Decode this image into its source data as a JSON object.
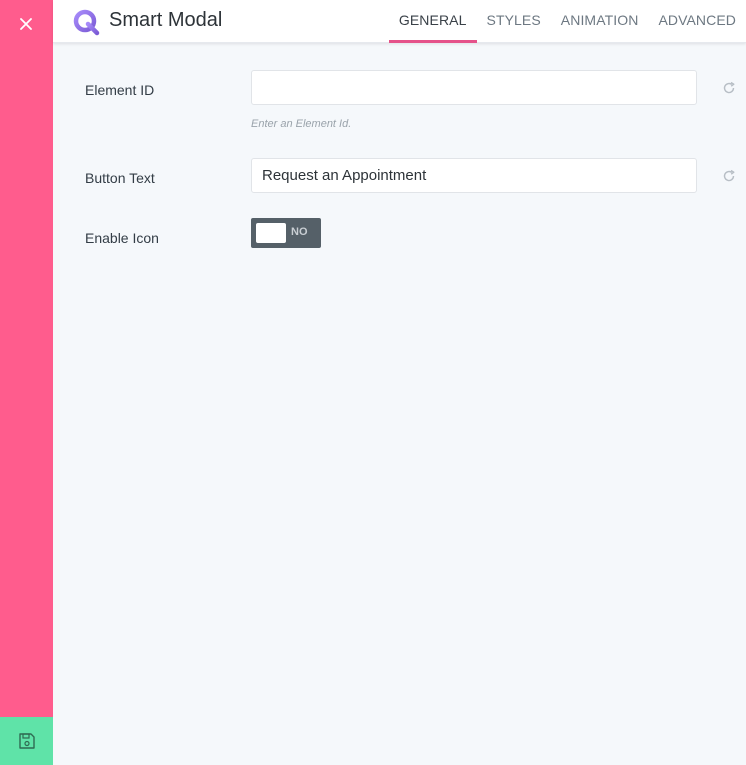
{
  "app": {
    "title": "Smart Modal",
    "colors": {
      "sidebar": "#ff5c8d",
      "save": "#5fe3a8",
      "accent": "#e5528a"
    }
  },
  "sidebar": {
    "close_icon": "close-icon",
    "save_icon": "save-icon"
  },
  "tabs": [
    {
      "label": "GENERAL",
      "active": true
    },
    {
      "label": "STYLES",
      "active": false
    },
    {
      "label": "ANIMATION",
      "active": false
    },
    {
      "label": "ADVANCED",
      "active": false
    }
  ],
  "form": {
    "element_id": {
      "label": "Element ID",
      "value": "",
      "hint": "Enter an Element Id."
    },
    "button_text": {
      "label": "Button Text",
      "value": "Request an Appointment"
    },
    "enable_icon": {
      "label": "Enable Icon",
      "state": "NO",
      "on": false
    }
  }
}
